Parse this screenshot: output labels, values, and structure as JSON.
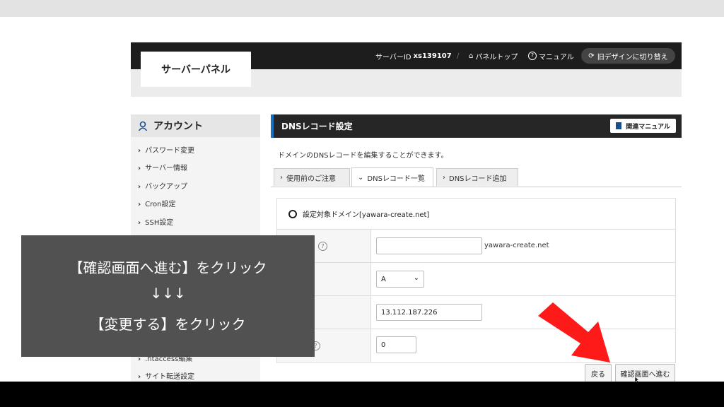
{
  "header": {
    "logo": "サーバーパネル",
    "server_id_label": "サーバーID",
    "server_id": "xs139107",
    "separator": "/",
    "panel_top": "パネルトップ",
    "manual": "マニュアル",
    "old_design": "旧デザインに切り替え"
  },
  "sidebar": {
    "heading": "アカウント",
    "items": [
      {
        "label": "パスワード変更"
      },
      {
        "label": "サーバー情報"
      },
      {
        "label": "バックアップ"
      },
      {
        "label": "Cron設定"
      },
      {
        "label": "SSH設定"
      },
      {
        "label": ".htaccess編集"
      },
      {
        "label": "サイト転送設定"
      }
    ]
  },
  "main": {
    "title": "DNSレコード設定",
    "manual_button": "関連マニュアル",
    "description": "ドメインのDNSレコードを編集することができます。",
    "tabs": [
      {
        "label": "使用前のご注意",
        "icon": "›"
      },
      {
        "label": "DNSレコード一覧",
        "icon": "⌄"
      },
      {
        "label": "DNSレコード追加",
        "icon": "›"
      }
    ],
    "target_domain": "設定対象ドメイン[yawara-create.net]",
    "form": {
      "host_value": "",
      "host_suffix": "yawara-create.net",
      "type_value": "A",
      "content_value": "13.112.187.226",
      "priority_value": "0"
    },
    "back_button": "戻る",
    "confirm_button": "確認画面へ進む"
  },
  "overlay": {
    "line1": "【確認画面へ進む】をクリック",
    "line2": "↓↓↓",
    "line3": "【変更する】をクリック"
  },
  "colors": {
    "header_dark": "#1d1d1d",
    "accent_blue": "#1a6fbf",
    "arrow_red": "#ff1a1a"
  }
}
